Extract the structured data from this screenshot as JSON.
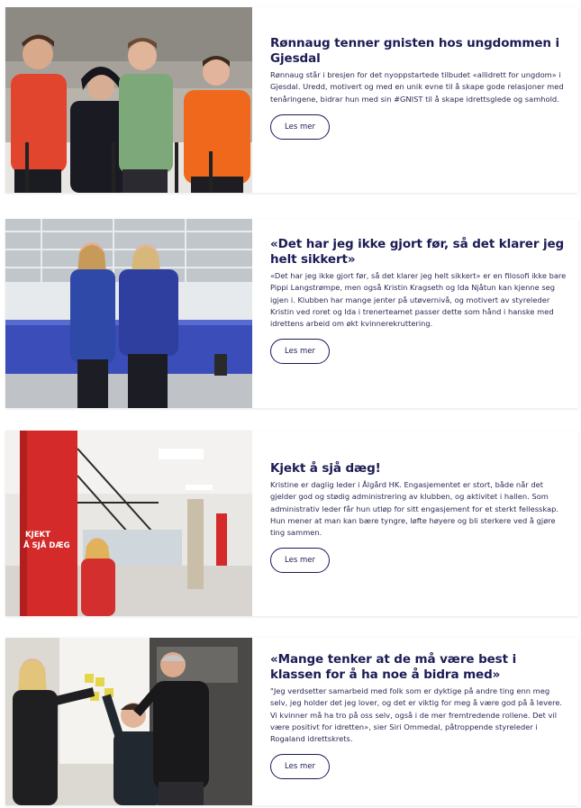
{
  "articles": [
    {
      "title": "Rønnaug tenner gnisten hos ungdommen i Gjesdal",
      "text": "Rønnaug står i bresjen for det nyoppstartede tilbudet «allidrett for ungdom» i Gjesdal. Uredd, motivert og med en unik evne til å skape gode relasjoner med tenåringene, bidrar hun med sin #GNIST til å skape idrettsglede og samhold.",
      "button": "Les mer"
    },
    {
      "title": "«Det har jeg ikke gjort før, så det klarer jeg helt sikkert»",
      "text": "«Det har jeg ikke gjort før, så det klarer jeg helt sikkert» er en filosofi ikke bare Pippi Langstrømpe, men også Kristin Kragseth og Ida Njåtun kan kjenne seg igjen i. Klubben har mange jenter på utøvernivå, og motivert av styreleder Kristin ved roret og Ida i trenerteamet passer dette som hånd i hanske med idrettens arbeid om økt kvinnerekruttering.",
      "button": "Les mer"
    },
    {
      "title": "Kjekt å sjå dæg!",
      "text": "Kristine er daglig leder i Ålgård HK. Engasjementet er stort, både når det gjelder god og stødig administrering av klubben, og aktivitet i hallen. Som administrativ leder får hun utløp for sitt engasjement for et sterkt fellesskap. Hun mener at man kan bære tyngre, løfte høyere og bli sterkere ved å gjøre ting sammen.",
      "button": "Les mer",
      "photo_text": "KJEKT\nÅ SJÅ DÆG"
    },
    {
      "title": "«Mange tenker at de må være best i klassen for å ha noe å bidra med»",
      "text": "\"Jeg verdsetter samarbeid med folk som er dyktige på andre ting enn meg selv, jeg holder det jeg lover, og det er viktig for meg å være god på å levere. Vi kvinner må ha tro på oss selv, også i de mer fremtredende rollene. Det vil være positivt for idretten», sier Siri Ommedal, påtroppende styreleder i Rogaland idrettskrets.",
      "button": "Les mer"
    }
  ],
  "colors": {
    "title": "#1c1b55",
    "pillar_red": "#d42a2a",
    "accent_blue": "#2a3fae"
  },
  "icons": [
    "photo-group-curling",
    "photo-ice-rink",
    "photo-sports-hall",
    "photo-office-team"
  ]
}
